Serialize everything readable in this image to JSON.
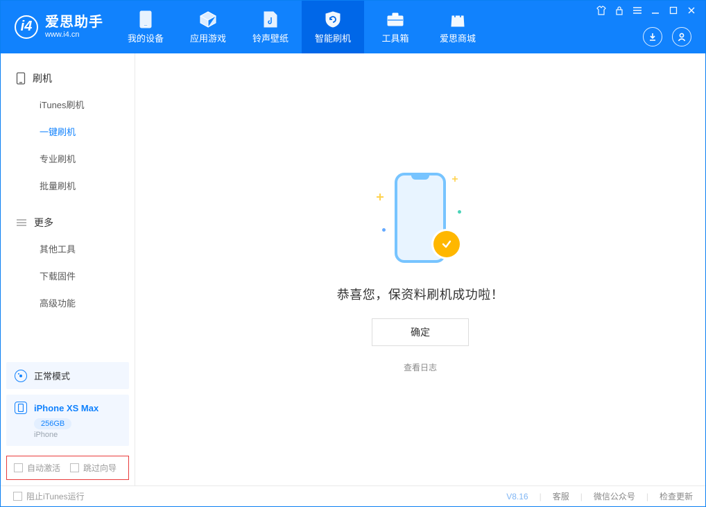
{
  "app": {
    "name": "爱思助手",
    "url": "www.i4.cn"
  },
  "nav": {
    "items": [
      {
        "label": "我的设备"
      },
      {
        "label": "应用游戏"
      },
      {
        "label": "铃声壁纸"
      },
      {
        "label": "智能刷机"
      },
      {
        "label": "工具箱"
      },
      {
        "label": "爱思商城"
      }
    ],
    "activeIndex": 3
  },
  "sidebar": {
    "groups": [
      {
        "title": "刷机",
        "items": [
          "iTunes刷机",
          "一键刷机",
          "专业刷机",
          "批量刷机"
        ],
        "activeIndex": 1
      },
      {
        "title": "更多",
        "items": [
          "其他工具",
          "下载固件",
          "高级功能"
        ],
        "activeIndex": -1
      }
    ],
    "mode": "正常模式",
    "device": {
      "name": "iPhone XS Max",
      "capacity": "256GB",
      "type": "iPhone"
    },
    "options": {
      "autoActivate": "自动激活",
      "skipGuide": "跳过向导"
    }
  },
  "main": {
    "message": "恭喜您，保资料刷机成功啦！",
    "okButton": "确定",
    "logLink": "查看日志"
  },
  "footer": {
    "blockItunes": "阻止iTunes运行",
    "version": "V8.16",
    "links": [
      "客服",
      "微信公众号",
      "检查更新"
    ]
  }
}
